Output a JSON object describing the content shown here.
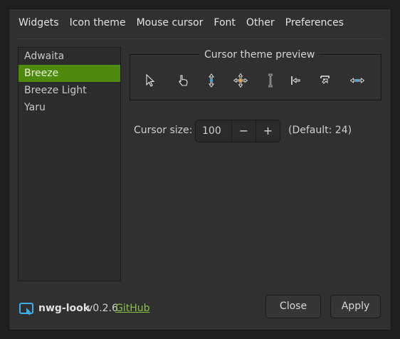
{
  "tabs": [
    {
      "label": "Widgets"
    },
    {
      "label": "Icon theme"
    },
    {
      "label": "Mouse cursor"
    },
    {
      "label": "Font"
    },
    {
      "label": "Other"
    },
    {
      "label": "Preferences"
    }
  ],
  "active_tab": "Mouse cursor",
  "theme_list": {
    "items": [
      {
        "label": "Adwaita"
      },
      {
        "label": "Breeze"
      },
      {
        "label": "Breeze Light"
      },
      {
        "label": "Yaru"
      }
    ],
    "selected": "Breeze"
  },
  "preview": {
    "title": "Cursor theme preview",
    "icons": [
      "default-arrow-cursor-icon",
      "hand-pointer-cursor-icon",
      "vertical-resize-cursor-icon",
      "move-cursor-icon",
      "text-beam-cursor-icon",
      "left-side-cursor-icon",
      "corner-cursor-icon",
      "horizontal-resize-cursor-icon"
    ]
  },
  "cursor_size": {
    "label": "Cursor size:",
    "value": "100",
    "minus": "−",
    "plus": "+",
    "default_text": "(Default: 24)"
  },
  "footer": {
    "app_name": "nwg-look",
    "version": "v0.2.6",
    "link_text": "GitHub",
    "close_label": "Close",
    "apply_label": "Apply"
  },
  "colors": {
    "accent": "#4e8a0c",
    "link": "#88c04a",
    "window_bg": "#303030"
  }
}
